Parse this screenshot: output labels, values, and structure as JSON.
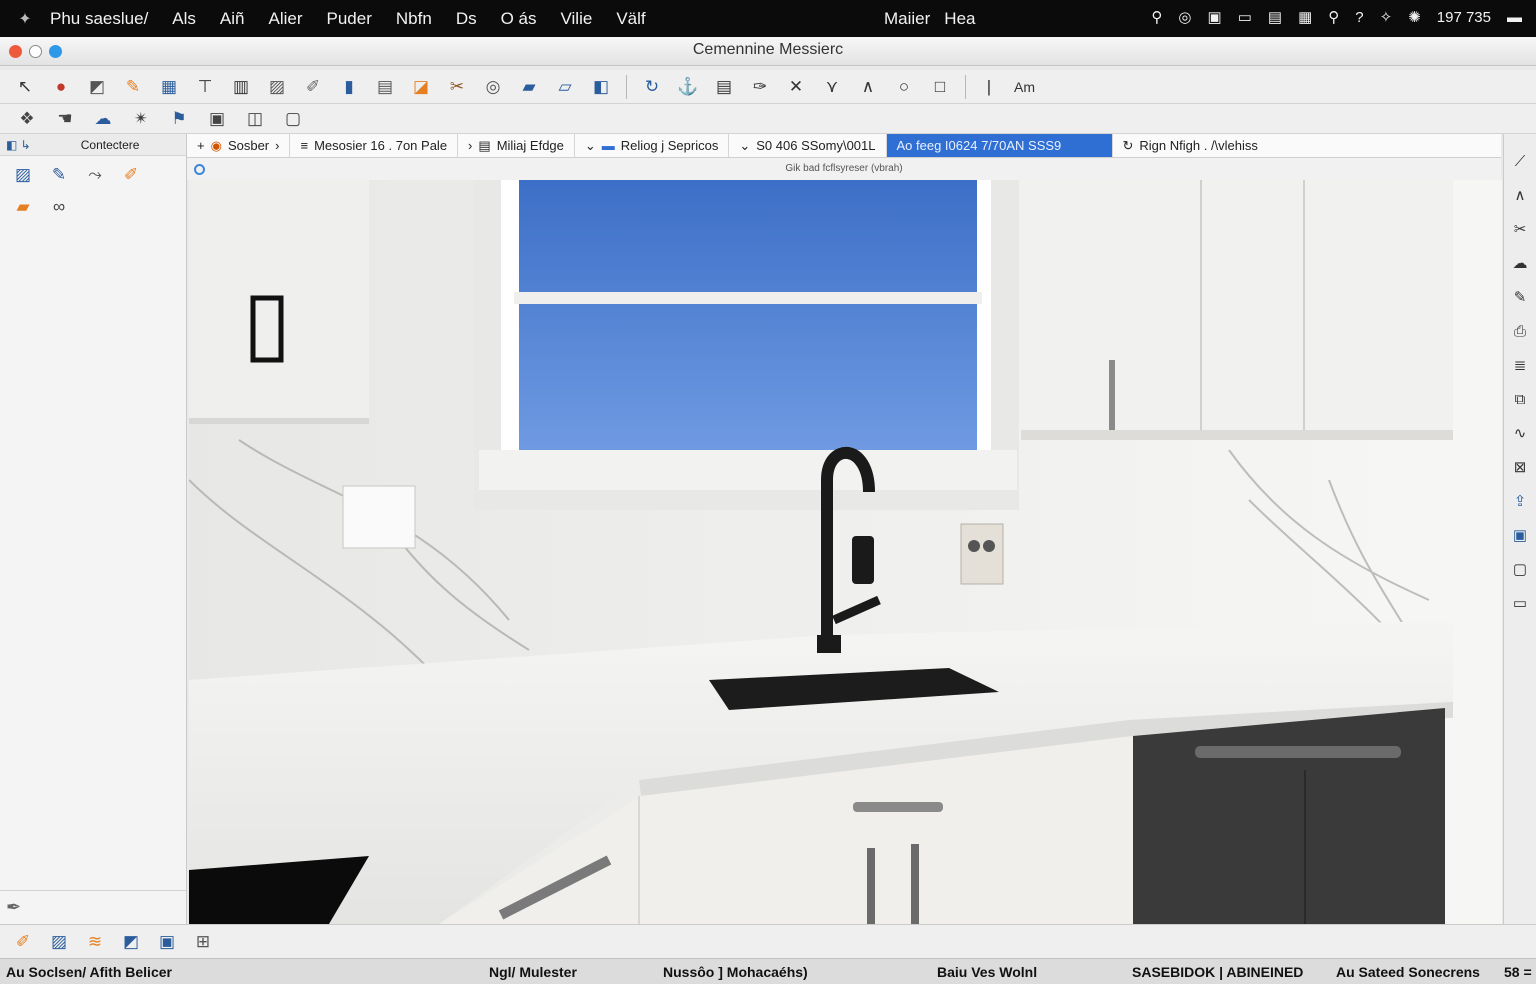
{
  "menubar": {
    "apple_icon": "logo-icon",
    "items": [
      "Phu saeslue/",
      "Als",
      "Aiñ",
      "Alier",
      "Puder",
      "Nbfn",
      "Ds",
      "O ás",
      "Vilie",
      "Välf"
    ],
    "center_items": [
      "Maiier",
      "Hea"
    ],
    "status_icons": [
      "location-icon",
      "target-icon",
      "display-icon",
      "tablet-icon",
      "battery-icon",
      "monitor-icon",
      "pin-icon",
      "question-icon",
      "spark-icon",
      "bug-icon"
    ],
    "clock": "197 735"
  },
  "window": {
    "title": "Cemennine Messierc",
    "controls": {
      "close_color": "#f05a3c",
      "minimize_color": "#e5e5e5",
      "zoom_color": "#2f98e9"
    }
  },
  "toolbar1": {
    "icons": [
      "cursor-icon",
      "record-icon",
      "shape-icon",
      "pen-icon",
      "grid-icon",
      "text-icon",
      "table-icon",
      "image-icon",
      "brush-icon",
      "column-icon",
      "layout-icon",
      "paint-icon",
      "wrench-icon",
      "disc-icon",
      "ruler-icon",
      "measure-icon",
      "cube-icon",
      "rotate-icon",
      "anchor-icon",
      "list-icon",
      "tag-icon",
      "close-icon",
      "merge-icon",
      "peak-icon",
      "circle-icon",
      "square-icon",
      "bar-icon"
    ],
    "trailing_label": "Am"
  },
  "toolbar2": {
    "icons": [
      "layers-icon",
      "hand-icon",
      "cloud-icon",
      "magic-icon",
      "flag-icon",
      "frame-icon",
      "panel-icon",
      "window-icon"
    ]
  },
  "left_panel": {
    "header_icon": "panel-icon",
    "header_label": "Contectere",
    "tools": [
      "photo-icon",
      "pencil-icon",
      "route-icon",
      "edit-icon",
      "folder-icon",
      "link-icon"
    ],
    "bottom_icon": "pen-icon"
  },
  "tabs": [
    {
      "label": "Sosber",
      "icon": "shield-icon",
      "active": false
    },
    {
      "label": "Mesosier 16 . 7on Pale",
      "icon": "list-icon",
      "active": false
    },
    {
      "label": "Miliaj  Efdge",
      "icon": "panel-icon",
      "active": false
    },
    {
      "label": "Reliog j  Sepricos",
      "icon": "card-icon",
      "active": false
    },
    {
      "label": "S0 406 SSomy\\001L",
      "icon": "chevron-icon",
      "active": false
    },
    {
      "label": "Ao feeg I0624 7/70AN SSS9",
      "icon": "",
      "active": true
    },
    {
      "label": "Rign Nfigh . /\\vlehiss",
      "icon": "refresh-icon",
      "active": false
    }
  ],
  "subbar": {
    "text": "Gik bad fcflsyreser (vbrah)"
  },
  "right_toolbar": {
    "icons": [
      "fold-icon",
      "chevron-icon",
      "cut-icon",
      "cloud-icon",
      "pencil-icon",
      "printer-icon",
      "stack-icon",
      "copy-icon",
      "wave-icon",
      "layers-icon",
      "export-icon",
      "window-icon",
      "camera-icon",
      "box-icon"
    ]
  },
  "bottom_toolbar": {
    "icons": [
      "brush-icon",
      "image-icon",
      "layers-icon",
      "frame-icon",
      "photo-icon",
      "link-icon"
    ]
  },
  "statusbar": {
    "left": "Au Soclsen/ Afith Belicer",
    "item2": "Ngl/ Mulester",
    "item3": "Nussôo ]  Mohacaéhs)",
    "item4": "Baiu Ves Wolnl",
    "item5": "SASEBIDOK | ABINEINED",
    "item6": "Au Sateed Sonecrens",
    "right": "58 ="
  }
}
